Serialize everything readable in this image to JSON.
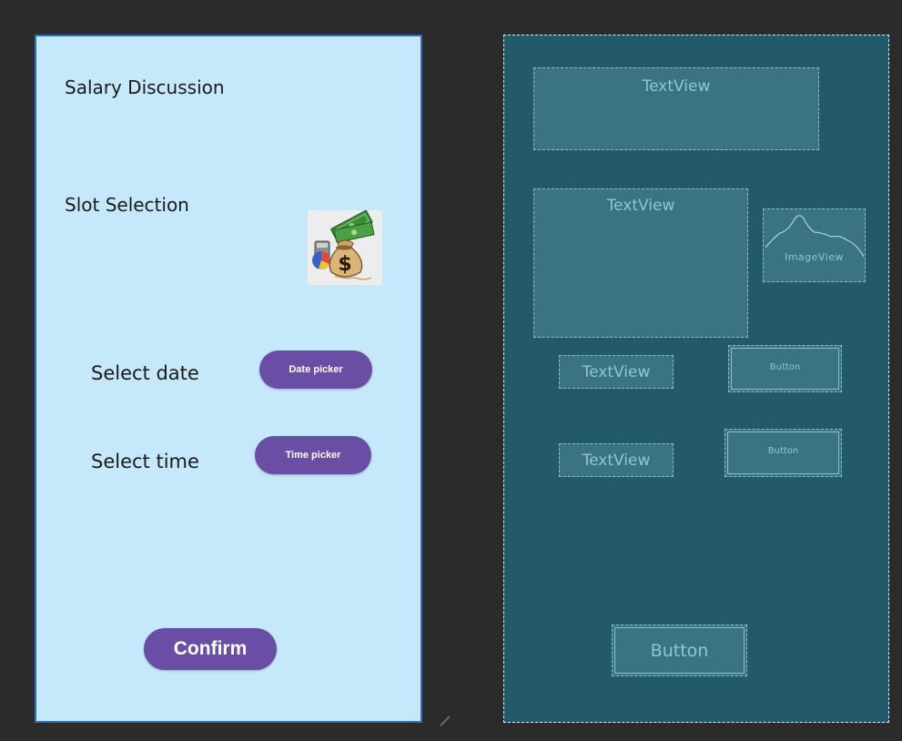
{
  "design": {
    "title": "Salary Discussion",
    "slot_selection": "Slot Selection",
    "date_label": "Select date",
    "time_label": "Select time",
    "date_button": "Date picker",
    "time_button": "Time picker",
    "confirm_button": "Confirm",
    "image_icon": "money-bag-icon"
  },
  "blueprint": {
    "textview_1": "TextView",
    "textview_2": "TextView",
    "imageview": "ImageView",
    "textview_3": "TextView",
    "button_1": "Button",
    "textview_4": "TextView",
    "button_2": "Button",
    "button_3": "Button"
  },
  "colors": {
    "editor_background": "#2b2b2b",
    "design_background": "#c5e8fb",
    "design_border": "#2f6fb7",
    "button_primary": "#6a4ea6",
    "blueprint_background": "#235a6a",
    "blueprint_outline": "#86c0cc"
  }
}
